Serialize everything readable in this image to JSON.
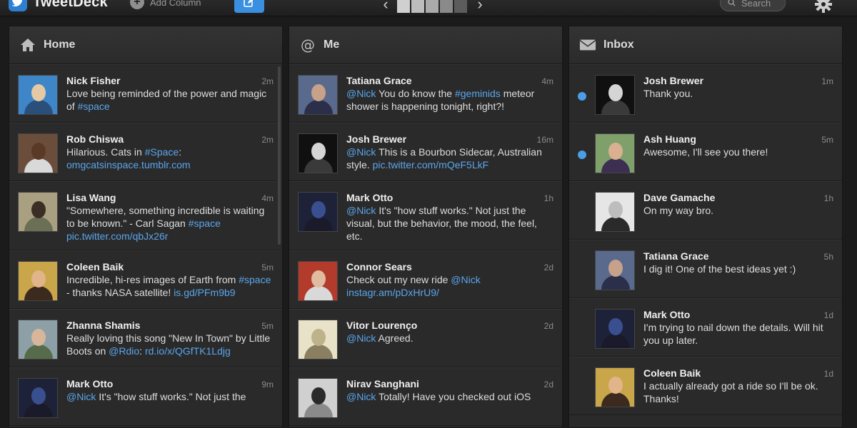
{
  "topbar": {
    "app_title": "TweetDeck",
    "add_column": "Add Column",
    "search_placeholder": "Search",
    "icons": {
      "logo": "bird-icon",
      "add": "plus-circle-icon",
      "compose": "compose-icon",
      "settings": "gear-icon"
    },
    "pager_colors": [
      "#d0d0d0",
      "#bdbdbd",
      "#aaaaaa",
      "#8a8a8a",
      "#5c5c5c"
    ]
  },
  "columns": [
    {
      "title": "Home",
      "icon": "home-icon",
      "items": [
        {
          "name": "Nick Fisher",
          "time": "2m",
          "avatar": [
            "#3f86c9",
            "#e4c9a5",
            "#2a4f7a"
          ],
          "parts": [
            {
              "t": "Love being reminded of the power and magic of "
            },
            {
              "t": "#space",
              "hl": true
            }
          ]
        },
        {
          "name": "Rob Chiswa",
          "time": "2m",
          "avatar": [
            "#6b4d3b",
            "#5a3a27",
            "#d9d9d9"
          ],
          "parts": [
            {
              "t": "Hilarious. Cats in "
            },
            {
              "t": "#Space",
              "hl": true
            },
            {
              "t": ": "
            },
            {
              "t": "omgcatsinspace.tumblr.com",
              "hl": true
            }
          ]
        },
        {
          "name": "Lisa Wang",
          "time": "4m",
          "avatar": [
            "#a9a082",
            "#3b2f25",
            "#6b6f55"
          ],
          "parts": [
            {
              "t": "\"Somewhere, something incredible is waiting to be known.\" - Carl Sagan "
            },
            {
              "t": "#space",
              "hl": true
            },
            {
              "t": " "
            },
            {
              "t": "pic.twitter.com/qbJx26r",
              "hl": true
            }
          ]
        },
        {
          "name": "Coleen Baik",
          "time": "5m",
          "avatar": [
            "#c9a64a",
            "#e2b48a",
            "#3b2a1d"
          ],
          "parts": [
            {
              "t": "Incredible, hi-res images of Earth from "
            },
            {
              "t": "#space",
              "hl": true
            },
            {
              "t": " - thanks NASA satellite! "
            },
            {
              "t": "is.gd/PFm9b9",
              "hl": true
            }
          ]
        },
        {
          "name": "Zhanna Shamis",
          "time": "5m",
          "avatar": [
            "#8da0a8",
            "#d7b69a",
            "#556b4a"
          ],
          "parts": [
            {
              "t": "Really loving this song \"New In Town\" by Little Boots on "
            },
            {
              "t": "@Rdio",
              "hl": true
            },
            {
              "t": ": "
            },
            {
              "t": "rd.io/x/QGfTK1Ldjg",
              "hl": true
            }
          ]
        },
        {
          "name": "Mark Otto",
          "time": "9m",
          "avatar": [
            "#1e2238",
            "#3a4f8f",
            "#1a1a2a"
          ],
          "parts": [
            {
              "t": "@Nick",
              "hl": true
            },
            {
              "t": " It's \"how stuff works.\" Not just the"
            }
          ]
        }
      ]
    },
    {
      "title": "Me",
      "icon": "at-icon",
      "items": [
        {
          "name": "Tatiana Grace",
          "time": "4m",
          "avatar": [
            "#5a6a8c",
            "#c8a18a",
            "#2b2f4a"
          ],
          "parts": [
            {
              "t": "@Nick",
              "hl": true
            },
            {
              "t": " You do know the "
            },
            {
              "t": "#geminids",
              "hl": true
            },
            {
              "t": " meteor shower is happening tonight, right?!"
            }
          ]
        },
        {
          "name": "Josh Brewer",
          "time": "16m",
          "avatar": [
            "#101010",
            "#d5d5d5",
            "#3a3a3a"
          ],
          "parts": [
            {
              "t": "@Nick",
              "hl": true
            },
            {
              "t": " This is a Bourbon Sidecar, Australian style. "
            },
            {
              "t": "pic.twitter.com/mQeF5LkF",
              "hl": true
            }
          ]
        },
        {
          "name": "Mark Otto",
          "time": "1h",
          "avatar": [
            "#1e2238",
            "#3a4f8f",
            "#1a1a2a"
          ],
          "parts": [
            {
              "t": "@Nick",
              "hl": true
            },
            {
              "t": " It's \"how stuff works.\" Not just the visual, but the behavior, the mood, the feel, etc."
            }
          ]
        },
        {
          "name": "Connor Sears",
          "time": "2d",
          "avatar": [
            "#b23b2c",
            "#e0bba0",
            "#d9d9d9"
          ],
          "parts": [
            {
              "t": "Check out my new ride "
            },
            {
              "t": "@Nick",
              "hl": true
            },
            {
              "t": " "
            },
            {
              "t": "instagr.am/pDxHrU9/",
              "hl": true
            }
          ]
        },
        {
          "name": "Vitor Lourenço",
          "time": "2d",
          "avatar": [
            "#e8e2c8",
            "#bdb28a",
            "#8a7f60"
          ],
          "parts": [
            {
              "t": "@Nick",
              "hl": true
            },
            {
              "t": " Agreed."
            }
          ]
        },
        {
          "name": "Nirav Sanghani",
          "time": "2d",
          "avatar": [
            "#d0d0d0",
            "#2a2a2a",
            "#8a8a8a"
          ],
          "parts": [
            {
              "t": "@Nick",
              "hl": true
            },
            {
              "t": " Totally! Have you checked out iOS"
            }
          ]
        }
      ]
    },
    {
      "title": "Inbox",
      "icon": "envelope-icon",
      "items": [
        {
          "name": "Josh Brewer",
          "time": "1m",
          "unread": true,
          "avatar": [
            "#101010",
            "#d5d5d5",
            "#3a3a3a"
          ],
          "parts": [
            {
              "t": "Thank you."
            }
          ]
        },
        {
          "name": "Ash Huang",
          "time": "5m",
          "unread": true,
          "avatar": [
            "#7fa06a",
            "#d9b090",
            "#3d2f52"
          ],
          "parts": [
            {
              "t": "Awesome, I'll see you there!"
            }
          ]
        },
        {
          "name": "Dave Gamache",
          "time": "1h",
          "avatar": [
            "#e6e6e6",
            "#bdbdbd",
            "#2a2a2a"
          ],
          "parts": [
            {
              "t": "On my way bro."
            }
          ]
        },
        {
          "name": "Tatiana Grace",
          "time": "5h",
          "avatar": [
            "#5a6a8c",
            "#c8a18a",
            "#2b2f4a"
          ],
          "parts": [
            {
              "t": "I dig it! One of the best ideas yet :)"
            }
          ]
        },
        {
          "name": "Mark Otto",
          "time": "1d",
          "avatar": [
            "#1e2238",
            "#3a4f8f",
            "#1a1a2a"
          ],
          "parts": [
            {
              "t": "I'm trying to nail down the details. Will hit you up later."
            }
          ]
        },
        {
          "name": "Coleen Baik",
          "time": "1d",
          "avatar": [
            "#c9a64a",
            "#e2b48a",
            "#3b2a1d"
          ],
          "parts": [
            {
              "t": "I actually already got a ride so I'll be ok. Thanks!"
            }
          ]
        }
      ]
    }
  ]
}
